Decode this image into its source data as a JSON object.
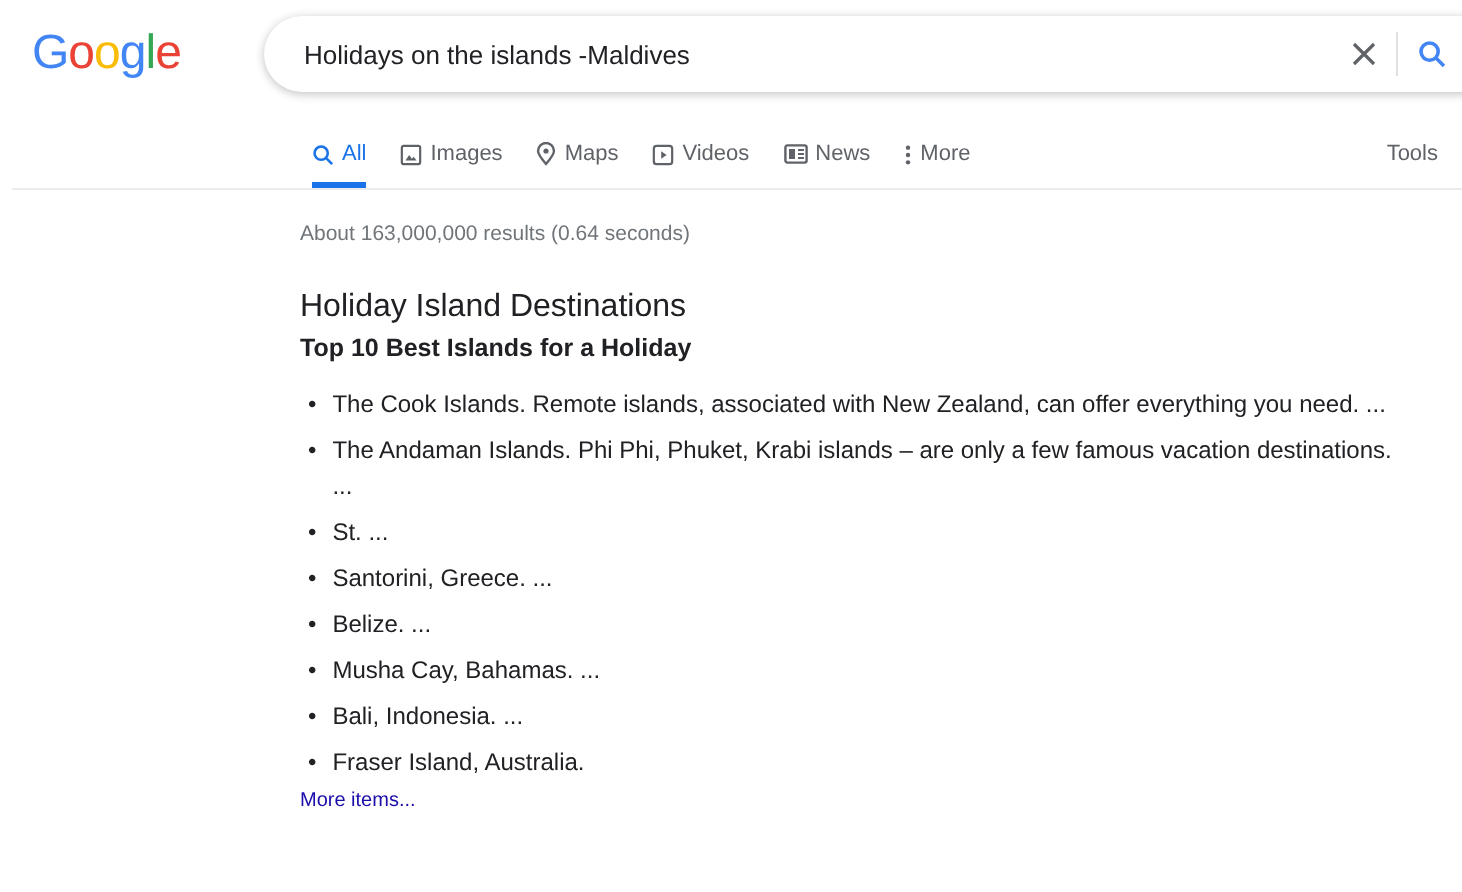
{
  "logo": "Google",
  "search": {
    "value": "Holidays on the islands -Maldives"
  },
  "tabs": [
    {
      "label": "All",
      "kind": "all",
      "selected": true
    },
    {
      "label": "Images",
      "kind": "images",
      "selected": false
    },
    {
      "label": "Maps",
      "kind": "maps",
      "selected": false
    },
    {
      "label": "Videos",
      "kind": "videos",
      "selected": false
    },
    {
      "label": "News",
      "kind": "news",
      "selected": false
    },
    {
      "label": "More",
      "kind": "more",
      "selected": false
    }
  ],
  "tools": "Tools",
  "result_stats": "About 163,000,000 results (0.64 seconds)",
  "snippet": {
    "title": "Holiday Island Destinations",
    "subtitle": "Top 10 Best Islands for a Holiday",
    "items": [
      {
        "marker": "•",
        "text": "The Cook Islands. Remote islands, associated with New Zealand, can offer everything you need. ..."
      },
      {
        "marker": "•",
        "text": "The Andaman Islands. Phi Phi, Phuket, Krabi islands – are only a few famous vacation destinations. ..."
      },
      {
        "marker": "•",
        "text": "St. ..."
      },
      {
        "marker": "•",
        "text": "Santorini, Greece. ..."
      },
      {
        "marker": "•",
        "text": "Belize. ..."
      },
      {
        "marker": "•",
        "text": "Musha Cay, Bahamas. ..."
      },
      {
        "marker": "•",
        "text": "Bali, Indonesia. ..."
      },
      {
        "marker": "•",
        "text": "Fraser Island, Australia."
      }
    ],
    "more_link": "More items..."
  }
}
